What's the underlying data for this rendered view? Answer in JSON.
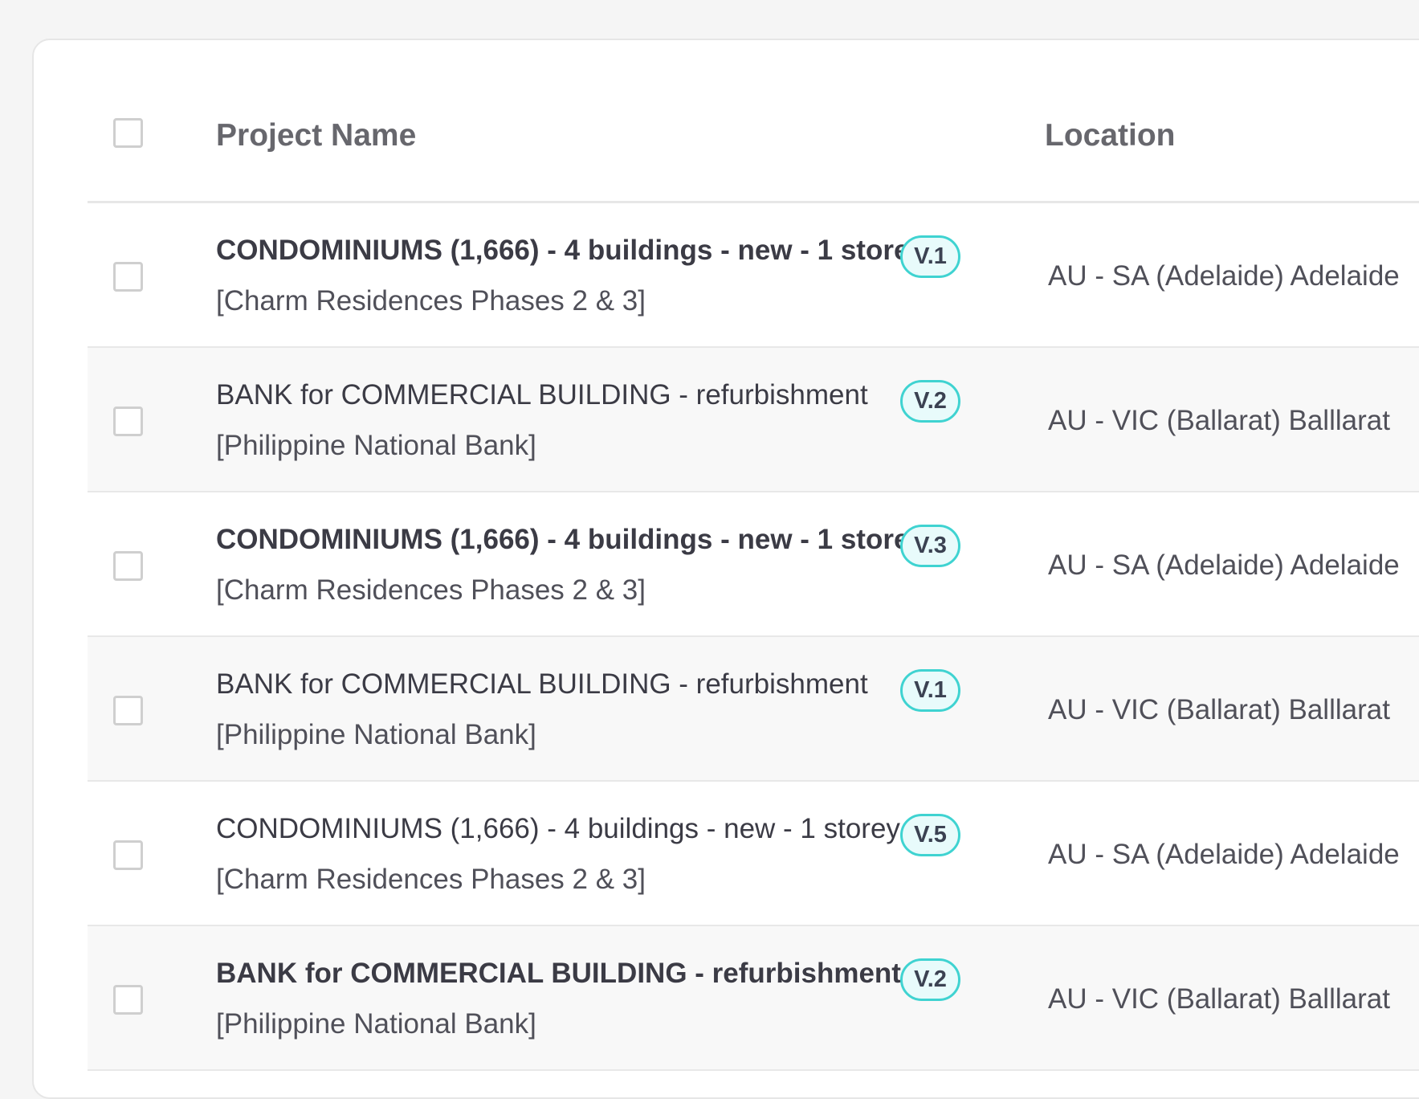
{
  "table": {
    "columns": {
      "project_name": "Project Name",
      "location": "Location"
    },
    "rows": [
      {
        "title": "CONDOMINIUMS (1,666) - 4 buildings - new - 1 storey",
        "subtitle": "[Charm Residences Phases 2 & 3]",
        "version": "V.1",
        "location": "AU - SA (Adelaide) Adelaide",
        "bold": true
      },
      {
        "title": "BANK for COMMERCIAL BUILDING - refurbishment",
        "subtitle": "[Philippine National Bank]",
        "version": "V.2",
        "location": "AU - VIC (Ballarat) Balllarat",
        "bold": false
      },
      {
        "title": "CONDOMINIUMS (1,666) - 4 buildings - new - 1 storey",
        "subtitle": "[Charm Residences Phases 2 & 3]",
        "version": "V.3",
        "location": "AU - SA (Adelaide) Adelaide",
        "bold": true
      },
      {
        "title": "BANK for COMMERCIAL BUILDING - refurbishment",
        "subtitle": "[Philippine National Bank]",
        "version": "V.1",
        "location": "AU - VIC (Ballarat) Balllarat",
        "bold": false
      },
      {
        "title": "CONDOMINIUMS (1,666) - 4 buildings - new - 1 storey",
        "subtitle": "[Charm Residences Phases 2 & 3]",
        "version": "V.5",
        "location": "AU - SA (Adelaide) Adelaide",
        "bold": false
      },
      {
        "title": "BANK for COMMERCIAL BUILDING - refurbishment",
        "subtitle": "[Philippine National Bank]",
        "version": "V.2",
        "location": "AU - VIC (Ballarat) Balllarat",
        "bold": true
      }
    ]
  },
  "colors": {
    "page_background": "#f5f5f5",
    "card_background": "#ffffff",
    "alt_row_background": "#f8f8f8",
    "badge_border": "#3fd3d1",
    "badge_background": "#e8fbfb"
  }
}
